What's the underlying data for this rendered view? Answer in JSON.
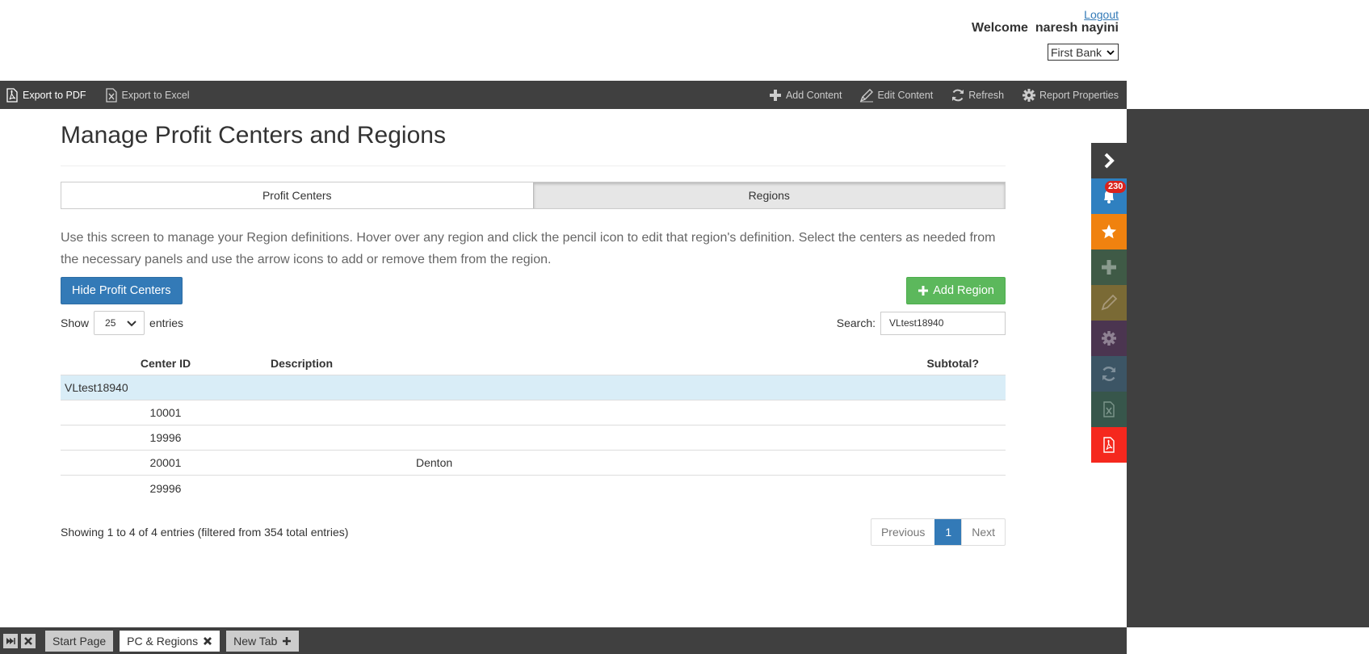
{
  "header": {
    "logout": "Logout",
    "welcome": "Welcome  naresh nayini",
    "bank": "First Bank"
  },
  "toolbar": {
    "export_pdf": "Export to PDF",
    "export_excel": "Export to Excel",
    "add_content": "Add Content",
    "edit_content": "Edit Content",
    "refresh": "Refresh",
    "report_properties": "Report Properties"
  },
  "sidebar": {
    "notification_count": "230",
    "colors": {
      "expand": "#404040",
      "notifications": "#2f80c0",
      "favorites": "#f0820f",
      "add": "#3f5a46",
      "edit": "#7a6a35",
      "settings": "#4b3550",
      "refresh": "#3c5565",
      "excel": "#37564b",
      "pdf": "#f5281e"
    }
  },
  "page": {
    "title": "Manage Profit Centers and Regions",
    "tabs": [
      "Profit Centers",
      "Regions"
    ],
    "active_tab": "Regions",
    "intro": "Use this screen to manage your Region definitions. Hover over any region and click the pencil icon to edit that region's definition. Select the centers as needed from the necessary panels and use the arrow icons to add or remove them from the region.",
    "hide_button": "Hide Profit Centers",
    "add_region_button": "Add Region"
  },
  "table_controls": {
    "show_label": "Show",
    "page_length": "25",
    "entries_label": "entries",
    "search_label": "Search:",
    "search_value": "VLtest18940"
  },
  "table": {
    "columns": [
      "Center ID",
      "Description",
      "Subtotal?"
    ],
    "group": "VLtest18940",
    "rows": [
      {
        "id": "10001",
        "description": "",
        "subtotal": ""
      },
      {
        "id": "19996",
        "description": "",
        "subtotal": ""
      },
      {
        "id": "20001",
        "description": "Denton",
        "subtotal": ""
      },
      {
        "id": "29996",
        "description": "",
        "subtotal": ""
      }
    ]
  },
  "footer": {
    "info": "Showing 1 to 4 of 4 entries (filtered from 354 total entries)",
    "previous": "Previous",
    "page": "1",
    "next": "Next"
  },
  "bottom_tabs": {
    "start_page": "Start Page",
    "pc_regions": "PC & Regions",
    "new_tab": "New Tab"
  }
}
